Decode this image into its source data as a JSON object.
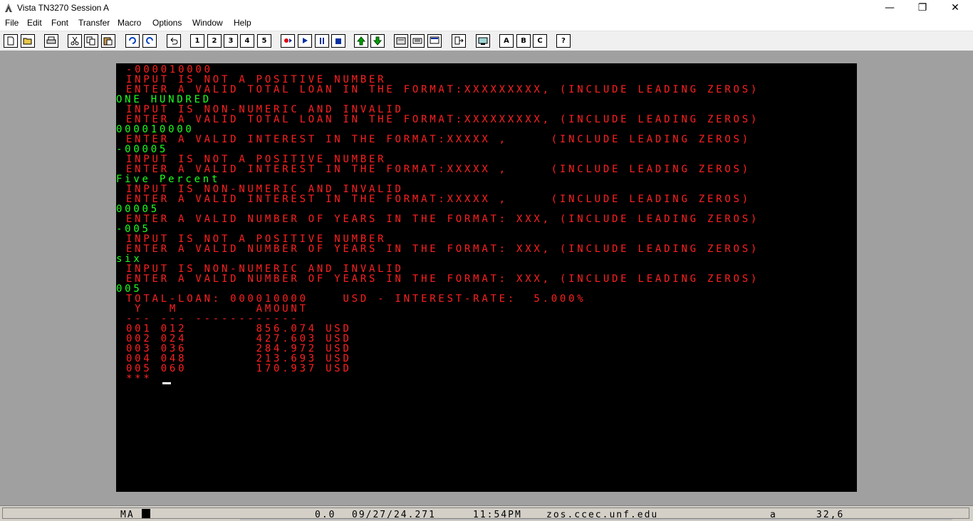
{
  "window": {
    "title": "Vista TN3270 Session A",
    "minimize": "—",
    "maximize": "❐",
    "close": "✕"
  },
  "menu": [
    "File",
    "Edit",
    "Font",
    "Transfer",
    "Macro",
    "Options",
    "Window",
    "Help"
  ],
  "toolbar": {
    "play_labels": [
      "1",
      "2",
      "3",
      "4",
      "5"
    ],
    "letter_labels": [
      "A",
      "B",
      "C"
    ],
    "help_label": "?"
  },
  "terminal": {
    "lines": [
      {
        "text": "-000010000",
        "color": "red",
        "indent": 1
      },
      {
        "text": "INPUT IS NOT A POSITIVE NUMBER",
        "color": "red",
        "indent": 1
      },
      {
        "text": "ENTER A VALID TOTAL LOAN IN THE FORMAT:XXXXXXXXX, (INCLUDE LEADING ZEROS)",
        "color": "red",
        "indent": 1
      },
      {
        "text": "ONE HUNDRED",
        "color": "green",
        "indent": 0
      },
      {
        "text": "INPUT IS NON-NUMERIC AND INVALID",
        "color": "red",
        "indent": 1
      },
      {
        "text": "ENTER A VALID TOTAL LOAN IN THE FORMAT:XXXXXXXXX, (INCLUDE LEADING ZEROS)",
        "color": "red",
        "indent": 1
      },
      {
        "text": "000010000",
        "color": "green",
        "indent": 0
      },
      {
        "text": "ENTER A VALID INTEREST IN THE FORMAT:XXXXX ,     (INCLUDE LEADING ZEROS)",
        "color": "red",
        "indent": 1
      },
      {
        "text": "-00005",
        "color": "green",
        "indent": 0
      },
      {
        "text": "INPUT IS NOT A POSITIVE NUMBER",
        "color": "red",
        "indent": 1
      },
      {
        "text": "ENTER A VALID INTEREST IN THE FORMAT:XXXXX ,     (INCLUDE LEADING ZEROS)",
        "color": "red",
        "indent": 1
      },
      {
        "text": "Five Percent",
        "color": "green",
        "indent": 0
      },
      {
        "text": "INPUT IS NON-NUMERIC AND INVALID",
        "color": "red",
        "indent": 1
      },
      {
        "text": "ENTER A VALID INTEREST IN THE FORMAT:XXXXX ,     (INCLUDE LEADING ZEROS)",
        "color": "red",
        "indent": 1
      },
      {
        "text": "00005",
        "color": "green",
        "indent": 0
      },
      {
        "text": "ENTER A VALID NUMBER OF YEARS IN THE FORMAT: XXX, (INCLUDE LEADING ZEROS)",
        "color": "red",
        "indent": 1
      },
      {
        "text": "-005",
        "color": "green",
        "indent": 0
      },
      {
        "text": "INPUT IS NOT A POSITIVE NUMBER",
        "color": "red",
        "indent": 1
      },
      {
        "text": "ENTER A VALID NUMBER OF YEARS IN THE FORMAT: XXX, (INCLUDE LEADING ZEROS)",
        "color": "red",
        "indent": 1
      },
      {
        "text": "six",
        "color": "green",
        "indent": 0
      },
      {
        "text": "INPUT IS NON-NUMERIC AND INVALID",
        "color": "red",
        "indent": 1
      },
      {
        "text": "ENTER A VALID NUMBER OF YEARS IN THE FORMAT: XXX, (INCLUDE LEADING ZEROS)",
        "color": "red",
        "indent": 1
      },
      {
        "text": "005",
        "color": "green",
        "indent": 0
      },
      {
        "text": "TOTAL-LOAN: 000010000    USD - INTEREST-RATE:  5.000%",
        "color": "red",
        "indent": 1
      },
      {
        "text": " Y   M         AMOUNT",
        "color": "red",
        "indent": 1
      },
      {
        "text": "--- --- ------------",
        "color": "red",
        "indent": 1
      },
      {
        "text": "001 012        856.074 USD",
        "color": "red",
        "indent": 1
      },
      {
        "text": "002 024        427.603 USD",
        "color": "red",
        "indent": 1
      },
      {
        "text": "003 036        284.972 USD",
        "color": "red",
        "indent": 1
      },
      {
        "text": "004 048        213.693 USD",
        "color": "red",
        "indent": 1
      },
      {
        "text": "005 060        170.937 USD",
        "color": "red",
        "indent": 1
      },
      {
        "text": "***",
        "color": "red",
        "indent": 1
      }
    ]
  },
  "status": {
    "mode": "MA",
    "timing": "0.0",
    "date": "09/27/24.271",
    "time": "11:54PM",
    "host": "zos.ccec.unf.edu",
    "shift": "a",
    "cursor_pos": "32,6"
  },
  "colors": {
    "red": "#ff2020",
    "green": "#20ff20",
    "screen_bg": "#000000",
    "frame_bg": "#a0a0a0"
  }
}
